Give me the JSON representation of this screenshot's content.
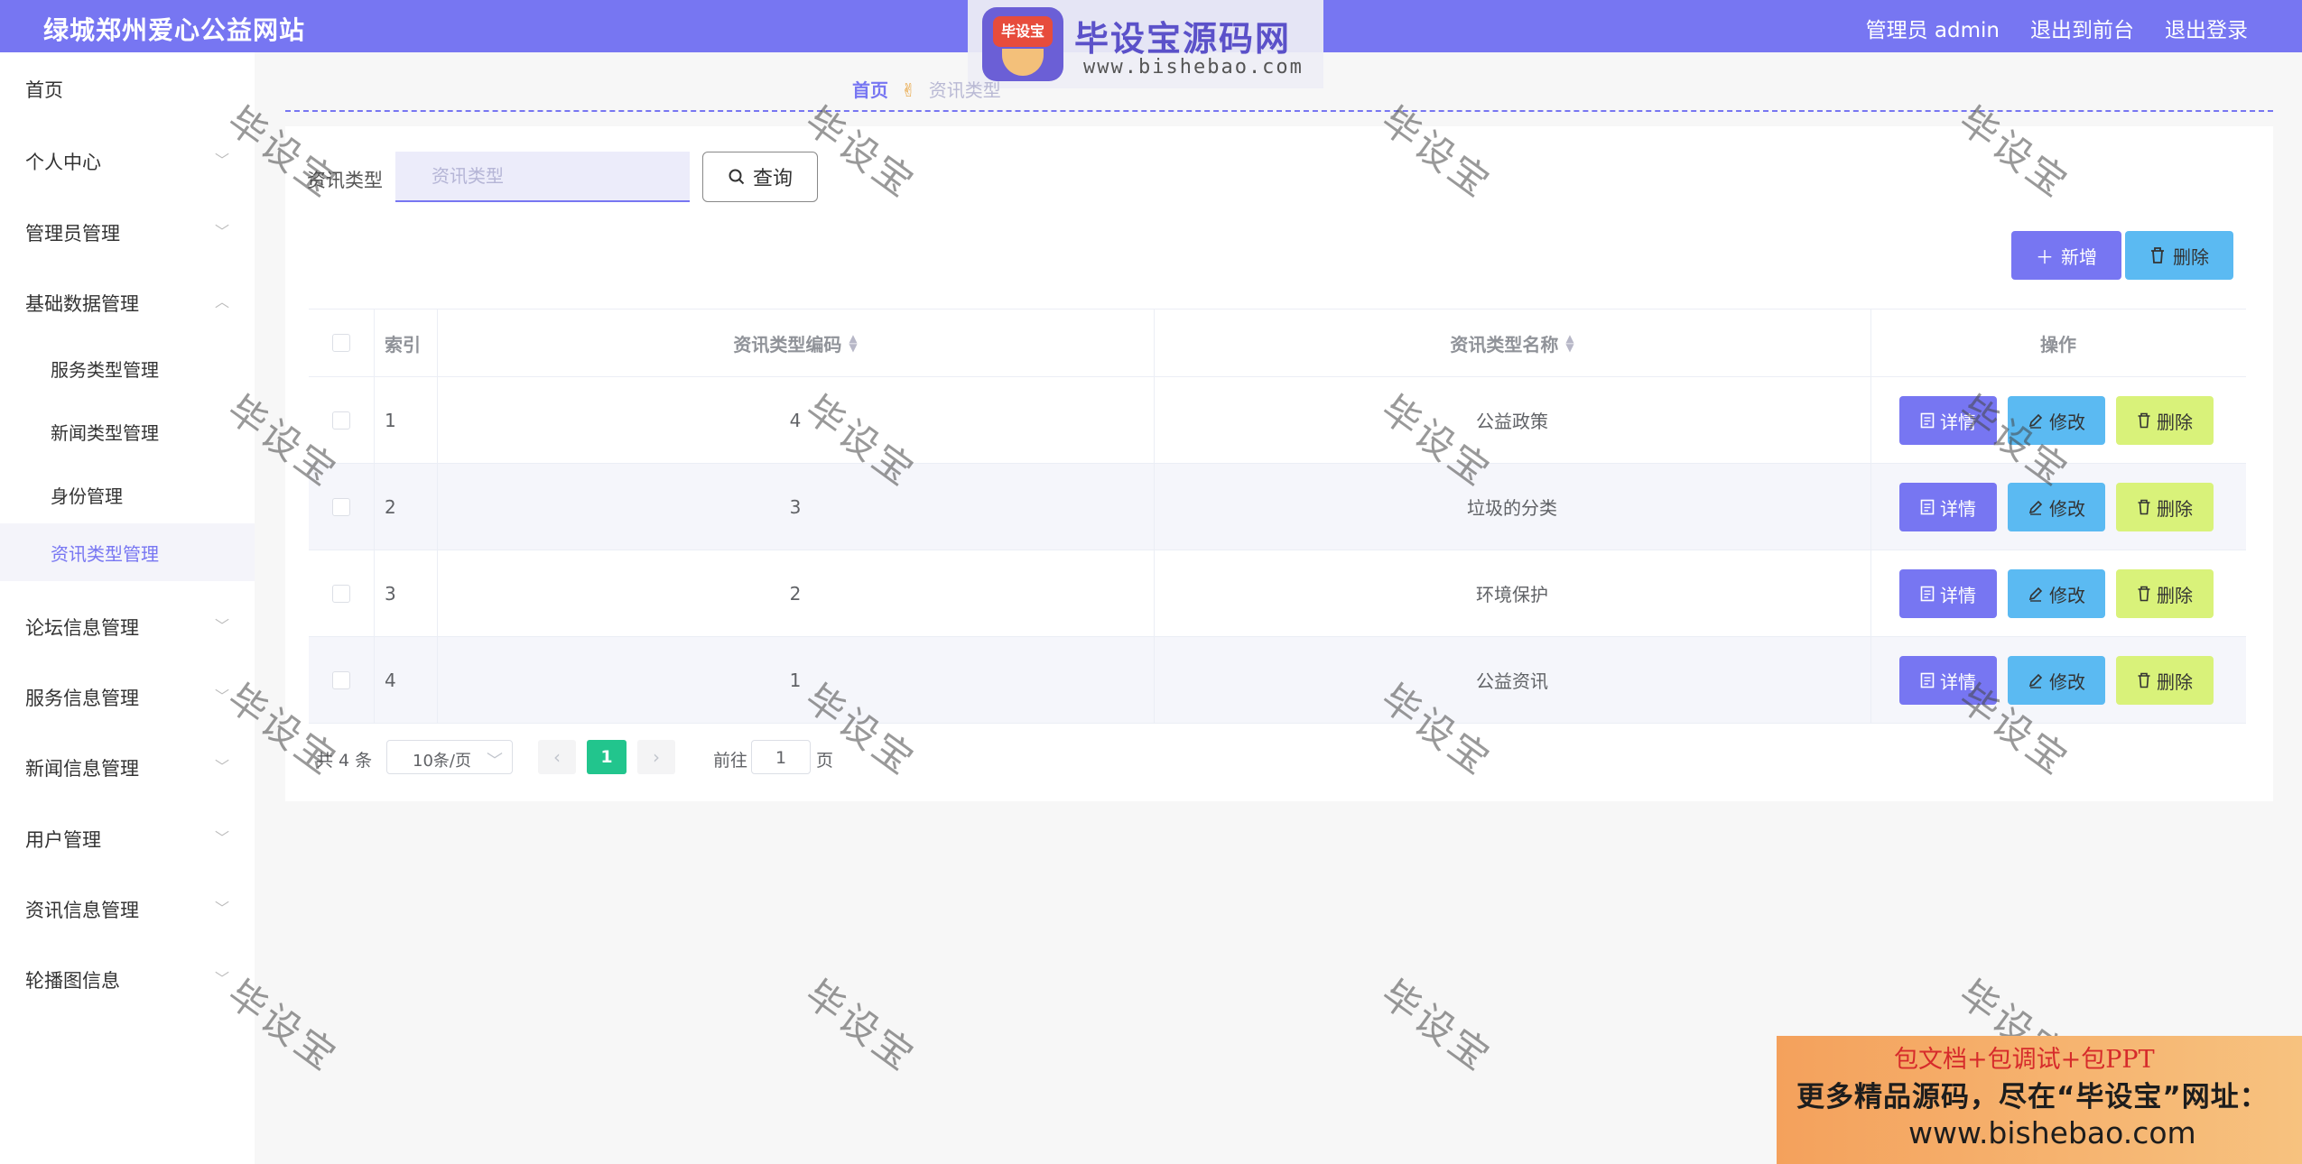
{
  "header": {
    "site_title": "绿城郑州爱心公益网站",
    "admin_label": "管理员 admin",
    "back_to_front": "退出到前台",
    "logout": "退出登录"
  },
  "logo": {
    "badge_text": "毕设宝",
    "main_text": "毕设宝源码网",
    "url_text": "www.bishebao.com"
  },
  "sidebar": {
    "items": [
      {
        "label": "首页"
      },
      {
        "label": "个人中心"
      },
      {
        "label": "管理员管理"
      },
      {
        "label": "基础数据管理"
      },
      {
        "label": "论坛信息管理"
      },
      {
        "label": "服务信息管理"
      },
      {
        "label": "新闻信息管理"
      },
      {
        "label": "用户管理"
      },
      {
        "label": "资讯信息管理"
      },
      {
        "label": "轮播图信息"
      }
    ],
    "sub_items": [
      {
        "label": "服务类型管理"
      },
      {
        "label": "新闻类型管理"
      },
      {
        "label": "身份管理"
      },
      {
        "label": "资讯类型管理"
      }
    ]
  },
  "breadcrumb": {
    "home": "首页",
    "current": "资讯类型"
  },
  "search": {
    "label": "资讯类型",
    "placeholder": "资讯类型",
    "button": "查询"
  },
  "toolbar": {
    "add": "新增",
    "delete": "删除"
  },
  "table": {
    "headers": {
      "index": "索引",
      "code": "资讯类型编码",
      "name": "资讯类型名称",
      "actions": "操作"
    },
    "rows": [
      {
        "index": "1",
        "code": "4",
        "name": "公益政策"
      },
      {
        "index": "2",
        "code": "3",
        "name": "垃圾的分类"
      },
      {
        "index": "3",
        "code": "2",
        "name": "环境保护"
      },
      {
        "index": "4",
        "code": "1",
        "name": "公益资讯"
      }
    ],
    "row_actions": {
      "detail": "详情",
      "edit": "修改",
      "delete": "删除"
    }
  },
  "pagination": {
    "total": "共 4 条",
    "page_size": "10条/页",
    "current_page": "1",
    "goto_label": "前往",
    "goto_value": "1",
    "goto_unit": "页"
  },
  "watermark": "毕设宝",
  "ad": {
    "line1": "包文档+包调试+包PPT",
    "line2": "更多精品源码，尽在“毕设宝”网址：",
    "line3": "www.bishebao.com"
  },
  "colors": {
    "primary": "#7776f2",
    "info": "#5bbaf2",
    "warn": "#d9f27a",
    "page_active": "#22c58d"
  }
}
